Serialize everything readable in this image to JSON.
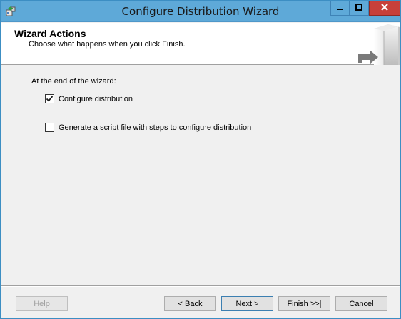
{
  "window": {
    "title": "Configure Distribution Wizard"
  },
  "header": {
    "title": "Wizard Actions",
    "subtitle": "Choose what happens when you click Finish."
  },
  "body": {
    "intro": "At the end of the wizard:",
    "options": [
      {
        "label": "Configure distribution",
        "checked": true
      },
      {
        "label": "Generate a script file with steps to configure distribution",
        "checked": false
      }
    ]
  },
  "footer": {
    "help": "Help",
    "back": "< Back",
    "next": "Next >",
    "finish": "Finish >>|",
    "cancel": "Cancel"
  },
  "icons": {
    "app": "wizard-app-icon",
    "minimize": "minimize-icon",
    "maximize": "maximize-icon",
    "close": "close-icon",
    "header_art": "server-arrow-icon"
  },
  "colors": {
    "titlebar": "#5ea9d8",
    "close_button": "#c7403a",
    "header_bg": "#ffffff",
    "dialog_bg": "#f0f0f0"
  }
}
